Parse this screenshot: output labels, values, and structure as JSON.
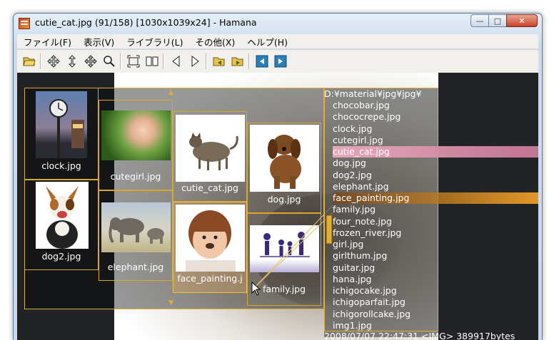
{
  "window": {
    "title": "cutie_cat.jpg (91/158) [1030x1039x24] - Hamana",
    "minimize": "—",
    "maximize": "□",
    "close": "✕"
  },
  "menu": [
    "ファイル(F)",
    "表示(V)",
    "ライブラリ(L)",
    "その他(X)",
    "ヘルプ(H)"
  ],
  "toolbar": {
    "buttons": [
      "open-folder-icon",
      "move-icon",
      "move-vertical-icon",
      "move-all-icon",
      "zoom-icon",
      "fit-screen-icon",
      "two-page-icon",
      "prev-icon",
      "next-icon",
      "prev-folder-icon",
      "next-folder-icon",
      "back-icon",
      "forward-icon"
    ]
  },
  "thumbnails": [
    {
      "label": "clock.jpg"
    },
    {
      "label": "cutegirl.jpg"
    },
    {
      "label": "cutie_cat.jpg"
    },
    {
      "label": "dog.jpg"
    },
    {
      "label": "dog2.jpg"
    },
    {
      "label": "elephant.jpg"
    },
    {
      "label": "face_painting.j"
    },
    {
      "label": "family.jpg"
    }
  ],
  "filelist": {
    "path": "D:¥material¥jpg¥jpg¥",
    "files": [
      "chocobar.jpg",
      "chococrepe.jpg",
      "clock.jpg",
      "cutegirl.jpg",
      "cutie_cat.jpg",
      "dog.jpg",
      "dog2.jpg",
      "elephant.jpg",
      "face_painting.jpg",
      "family.jpg",
      "four_note.jpg",
      "frozen_river.jpg",
      "girl.jpg",
      "girlthum.jpg",
      "guitar.jpg",
      "hana.jpg",
      "ichigocake.jpg",
      "ichigoparfait.jpg",
      "ichigorollcake.jpg",
      "img1.jpg"
    ],
    "current": "cutie_cat.jpg",
    "hover": "face_painting.jpg",
    "status": "2008/07/07 22:47:31 <IMG> 389917bytes"
  },
  "colors": {
    "accent": "#e0b030",
    "current_row": "#d88aa6",
    "hover_row": "#f0a030"
  }
}
